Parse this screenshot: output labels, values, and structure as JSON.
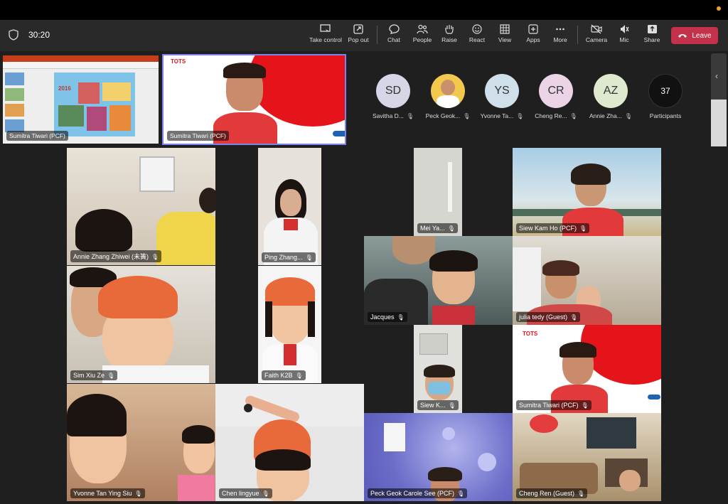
{
  "meeting": {
    "timer": "30:20",
    "toolbar": [
      {
        "id": "take-control",
        "label": "Take control",
        "icon": "take-control-icon"
      },
      {
        "id": "pop-out",
        "label": "Pop out",
        "icon": "pop-out-icon"
      },
      {
        "id": "chat",
        "label": "Chat",
        "icon": "chat-icon"
      },
      {
        "id": "people",
        "label": "People",
        "icon": "people-icon"
      },
      {
        "id": "raise",
        "label": "Raise",
        "icon": "raise-hand-icon"
      },
      {
        "id": "react",
        "label": "React",
        "icon": "smiley-icon"
      },
      {
        "id": "view",
        "label": "View",
        "icon": "grid-icon"
      },
      {
        "id": "apps",
        "label": "Apps",
        "icon": "plus-icon"
      },
      {
        "id": "more",
        "label": "More",
        "icon": "more-icon"
      },
      {
        "id": "camera",
        "label": "Camera",
        "icon": "camera-off-icon"
      },
      {
        "id": "mic",
        "label": "Mic",
        "icon": "mic-off-icon"
      },
      {
        "id": "share",
        "label": "Share",
        "icon": "share-icon"
      }
    ],
    "leave_label": "Leave"
  },
  "top_thumbs": [
    {
      "name": "Sumitra Tiwari (PCF)"
    },
    {
      "name": "Sumitra Tiwari (PCF)"
    }
  ],
  "roster": [
    {
      "initials": "SD",
      "name": "Savitha D...",
      "color": "#d6d6e6"
    },
    {
      "initials": "",
      "name": "Peck Geok...",
      "color": "#f2c94c"
    },
    {
      "initials": "YS",
      "name": "Yvonne Ta...",
      "color": "#cfe0ea"
    },
    {
      "initials": "CR",
      "name": "Cheng Re...",
      "color": "#ead4e6"
    },
    {
      "initials": "AZ",
      "name": "Annie Zha...",
      "color": "#dfe9cf"
    }
  ],
  "participants": {
    "count": "37",
    "label": "Participants"
  },
  "tiles": [
    {
      "name": "Annie  Zhang Zhiwei (未簀)"
    },
    {
      "name": "Ping Zhang..."
    },
    {
      "name": "Mei Ya..."
    },
    {
      "name": "Siew Kam Ho (PCF)"
    },
    {
      "name": "Jacques"
    },
    {
      "name": "julia tedy (Guest)"
    },
    {
      "name": "Sim Xiu Ze"
    },
    {
      "name": "Faith K2B"
    },
    {
      "name": "Siew K..."
    },
    {
      "name": "Sumitra Tiwari (PCF)"
    },
    {
      "name": "Yvonne Tan Ying Siu"
    },
    {
      "name": "Chen lingyue"
    },
    {
      "name": "Peck Geok Carole See (PCF)"
    },
    {
      "name": "Cheng Ren (Guest)"
    }
  ],
  "slide": {
    "year": "2016",
    "brand": "TOTS"
  }
}
